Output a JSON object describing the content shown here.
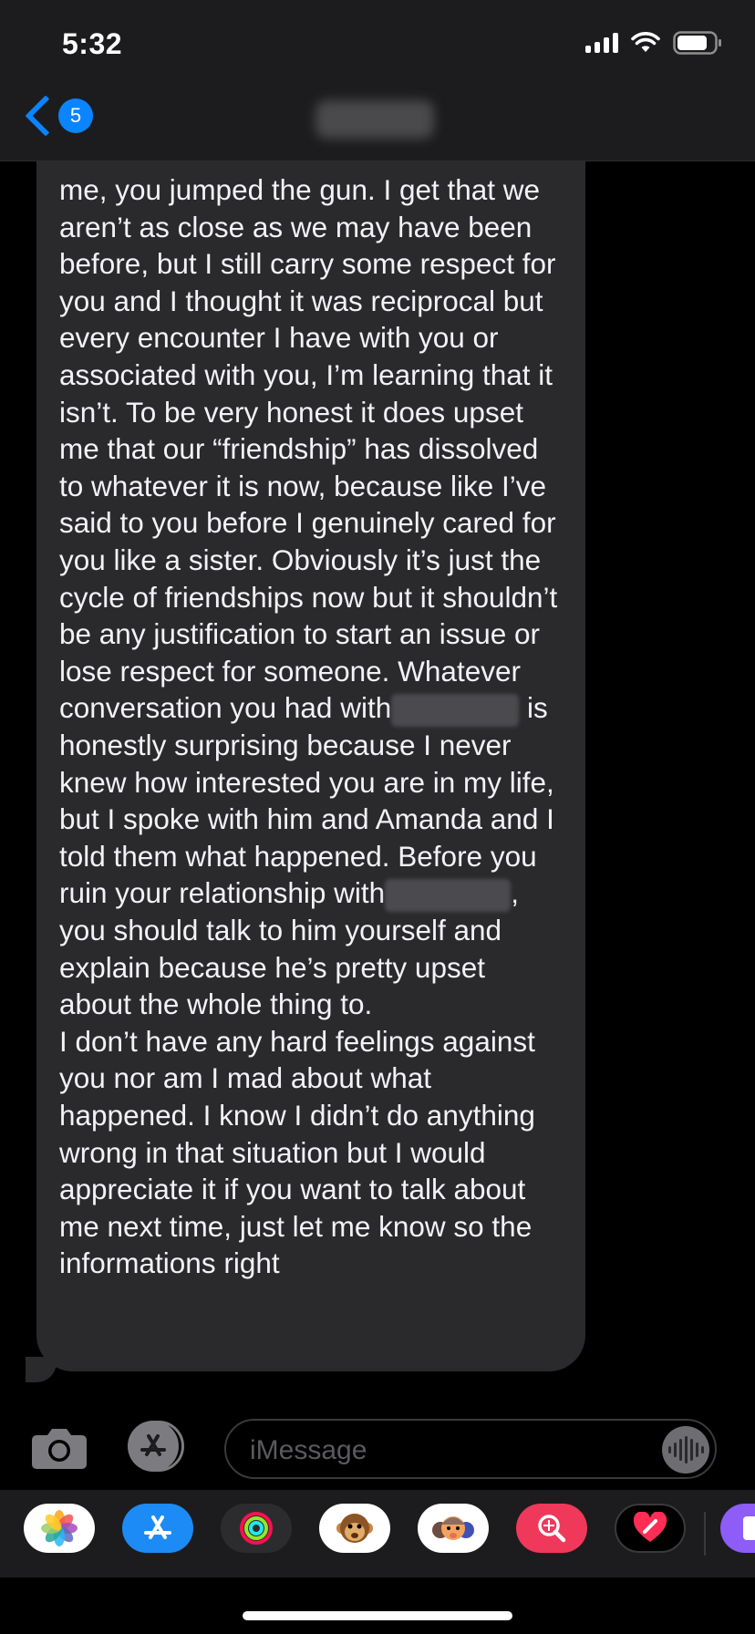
{
  "status_bar": {
    "time": "5:32"
  },
  "nav": {
    "back_badge_count": "5",
    "contact_name_blurred": true
  },
  "message": {
    "segments_before_redaction_1": "me, you jumped the gun. I get that we aren’t as close as we may have been before, but I still carry some respect for you and I thought it was reciprocal but every encounter I have with you or associated with you, I’m learning that it isn’t. To be very honest it does upset me that our “friendship” has dissolved to whatever it is now, because like I’ve said to you before I genuinely cared for you like a sister. Obviously it’s just the cycle of friendships now but it shouldn’t be any justification to start an issue or lose respect for someone. Whatever conversation you had with",
    "segment_after_redaction_1": " is honestly surprising because I never knew how interested you are in my life, but I spoke with him and Amanda and I told them what happened. Before you ruin your relationship with",
    "segment_after_redaction_2": ", you should talk to him yourself and explain because he’s pretty upset about the whole thing to.",
    "paragraph_2": "I don’t have any hard feelings against you nor am I mad about what happened. I know I didn’t do anything wrong in that situation but I would appreciate it if you want to talk about me next time, just let me know so the informations right"
  },
  "input": {
    "placeholder": "iMessage"
  },
  "app_drawer": {
    "apps": [
      {
        "name": "photos-icon",
        "bg": "#ffffff"
      },
      {
        "name": "app-store-icon",
        "bg": "#1c8bf5"
      },
      {
        "name": "activity-icon",
        "bg": "#2c2c2e"
      },
      {
        "name": "animoji-monkey-icon",
        "bg": "#ffffff"
      },
      {
        "name": "memoji-icon",
        "bg": "#ffffff"
      },
      {
        "name": "image-search-icon",
        "bg": "#f0385a"
      },
      {
        "name": "digital-touch-icon",
        "bg": "#000000"
      },
      {
        "name": "more-apps-icon",
        "bg": "#8e5cf7"
      }
    ]
  },
  "colors": {
    "accent": "#0a84ff",
    "bubble": "#2a2a2d",
    "background": "#000000"
  }
}
